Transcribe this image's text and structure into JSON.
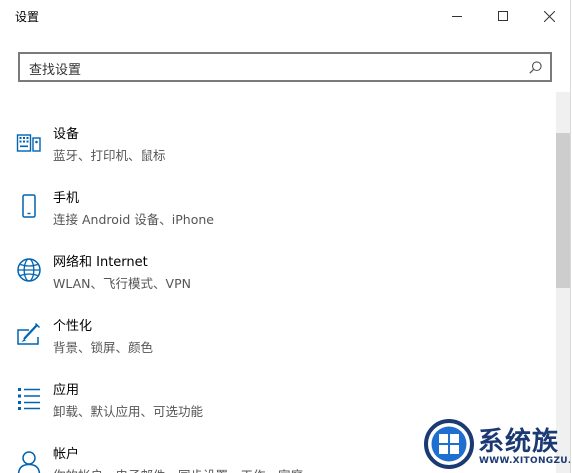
{
  "window": {
    "title": "设置"
  },
  "search": {
    "placeholder": "查找设置"
  },
  "items": [
    {
      "name": "设备",
      "desc": "蓝牙、打印机、鼠标",
      "icon": "keyboard-device-icon"
    },
    {
      "name": "手机",
      "desc": "连接 Android 设备、iPhone",
      "icon": "phone-icon"
    },
    {
      "name": "网络和 Internet",
      "desc": "WLAN、飞行模式、VPN",
      "icon": "globe-icon"
    },
    {
      "name": "个性化",
      "desc": "背景、锁屏、颜色",
      "icon": "personalization-icon"
    },
    {
      "name": "应用",
      "desc": "卸载、默认应用、可选功能",
      "icon": "apps-list-icon"
    },
    {
      "name": "帐户",
      "desc": "你的帐户、电子邮件、同步设置、工作、家庭",
      "icon": "person-icon"
    }
  ],
  "watermark": {
    "brand": "系统族",
    "url": "WWW.XITONGZU.COM"
  },
  "colors": {
    "accent": "#0063b1",
    "watermark": "#1b3a73"
  }
}
